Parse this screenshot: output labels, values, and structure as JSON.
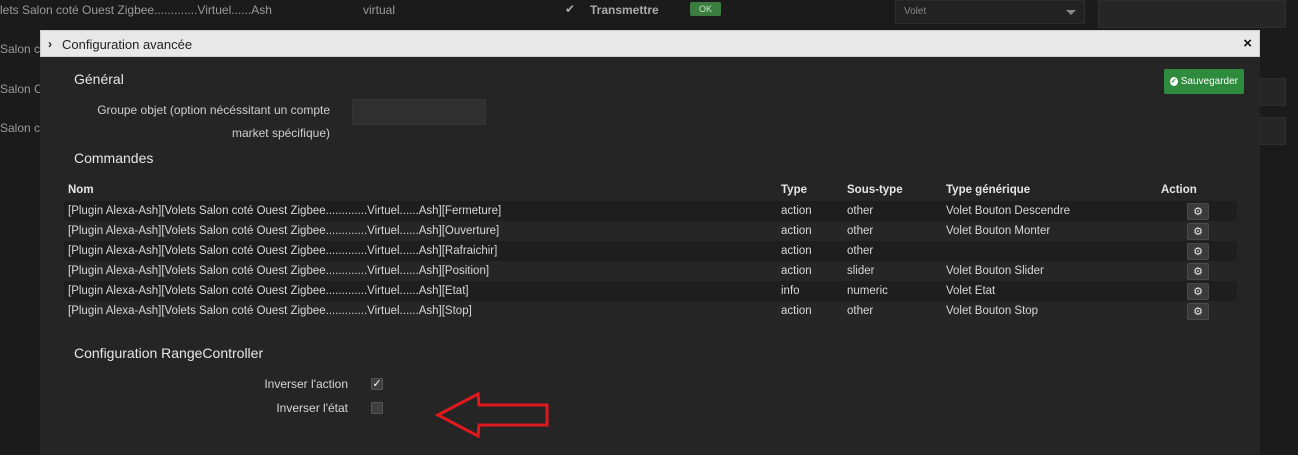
{
  "background": {
    "row1": {
      "name": "lets Salon coté Ouest Zigbee.............Virtuel......Ash",
      "type": "virtual",
      "transmit_label": "Transmettre",
      "ok_label": "OK",
      "select_value": "Volet"
    },
    "row2_name": "Salon coté",
    "row3_name": "Salon Coté",
    "row4_name": "Salon co"
  },
  "modal": {
    "title": "Configuration avancée",
    "close": "×",
    "save_label": "Sauvegarder",
    "general": {
      "title": "Général",
      "group_label_line1": "Groupe objet (option nécéssitant un compte",
      "group_label_line2": "market spécifique)",
      "group_value": ""
    },
    "commands": {
      "title": "Commandes",
      "headers": [
        "Nom",
        "Type",
        "Sous-type",
        "Type générique",
        "Action"
      ],
      "rows": [
        {
          "name": "[Plugin Alexa-Ash][Volets Salon coté Ouest Zigbee.............Virtuel......Ash][Fermeture]",
          "type": "action",
          "subtype": "other",
          "generic": "Volet Bouton Descendre"
        },
        {
          "name": "[Plugin Alexa-Ash][Volets Salon coté Ouest Zigbee.............Virtuel......Ash][Ouverture]",
          "type": "action",
          "subtype": "other",
          "generic": "Volet Bouton Monter"
        },
        {
          "name": "[Plugin Alexa-Ash][Volets Salon coté Ouest Zigbee.............Virtuel......Ash][Rafraichir]",
          "type": "action",
          "subtype": "other",
          "generic": ""
        },
        {
          "name": "[Plugin Alexa-Ash][Volets Salon coté Ouest Zigbee.............Virtuel......Ash][Position]",
          "type": "action",
          "subtype": "slider",
          "generic": "Volet Bouton Slider"
        },
        {
          "name": "[Plugin Alexa-Ash][Volets Salon coté Ouest Zigbee.............Virtuel......Ash][Etat]",
          "type": "info",
          "subtype": "numeric",
          "generic": "Volet Etat"
        },
        {
          "name": "[Plugin Alexa-Ash][Volets Salon coté Ouest Zigbee.............Virtuel......Ash][Stop]",
          "type": "action",
          "subtype": "other",
          "generic": "Volet Bouton Stop"
        }
      ]
    },
    "range": {
      "title": "Configuration RangeController",
      "invert_action_label": "Inverser l'action",
      "invert_action_checked": true,
      "invert_state_label": "Inverser l'état",
      "invert_state_checked": false
    }
  },
  "icons": {
    "gear": "gear-icon",
    "save": "check-circle-icon",
    "close": "close-icon",
    "annotation": "red-arrow-icon"
  },
  "colors": {
    "save_button": "#2e8b3d",
    "annotation_arrow": "#e0191e",
    "ok_badge": "#3a7d3f"
  }
}
